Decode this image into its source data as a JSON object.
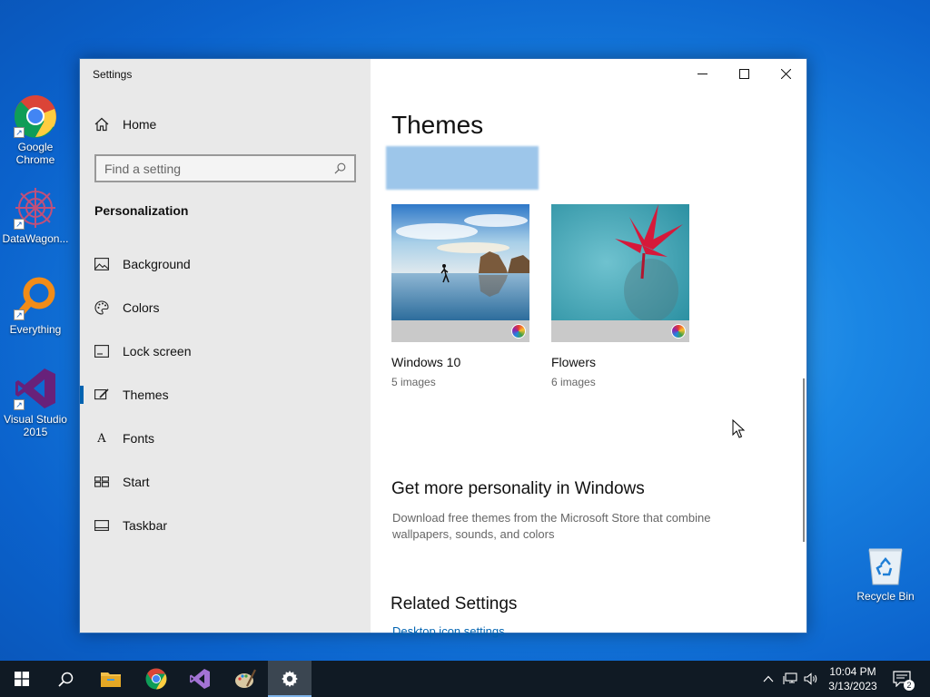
{
  "desktop": {
    "icons": [
      {
        "label_line1": "Google",
        "label_line2": "Chrome"
      },
      {
        "label_line1": "DataWagon...",
        "label_line2": ""
      },
      {
        "label_line1": "Everything",
        "label_line2": ""
      },
      {
        "label_line1": "Visual Studio",
        "label_line2": "2015"
      }
    ],
    "recycle_bin": "Recycle Bin"
  },
  "window": {
    "title": "Settings",
    "controls": [
      "minimize-icon",
      "maximize-icon",
      "close-icon"
    ]
  },
  "sidebar": {
    "home": "Home",
    "search_placeholder": "Find a setting",
    "section": "Personalization",
    "items": [
      {
        "label": "Background",
        "icon": "picture-icon"
      },
      {
        "label": "Colors",
        "icon": "palette-icon"
      },
      {
        "label": "Lock screen",
        "icon": "lock-screen-icon"
      },
      {
        "label": "Themes",
        "icon": "themes-brush-icon",
        "active": true
      },
      {
        "label": "Fonts",
        "icon": "font-icon"
      },
      {
        "label": "Start",
        "icon": "start-grid-icon"
      },
      {
        "label": "Taskbar",
        "icon": "taskbar-icon"
      }
    ]
  },
  "main": {
    "title": "Themes",
    "themes": [
      {
        "name": "Windows 10",
        "count": "5 images"
      },
      {
        "name": "Flowers",
        "count": "6 images"
      }
    ],
    "more": {
      "title": "Get more personality in Windows",
      "desc": "Download free themes from the Microsoft Store that combine wallpapers, sounds, and colors"
    },
    "related": {
      "title": "Related Settings",
      "link": "Desktop icon settings"
    }
  },
  "taskbar": {
    "apps": [
      "start-icon",
      "search-icon",
      "file-explorer-icon",
      "chrome-icon",
      "visual-studio-icon",
      "paint-icon",
      "settings-gear-icon"
    ],
    "time": "10:04 PM",
    "date": "3/13/2023",
    "notification_count": "2"
  },
  "colors": {
    "accent": "#0063b1",
    "sidebar_bg": "#e9e9e9",
    "taskbar_bg": "#101a24"
  }
}
